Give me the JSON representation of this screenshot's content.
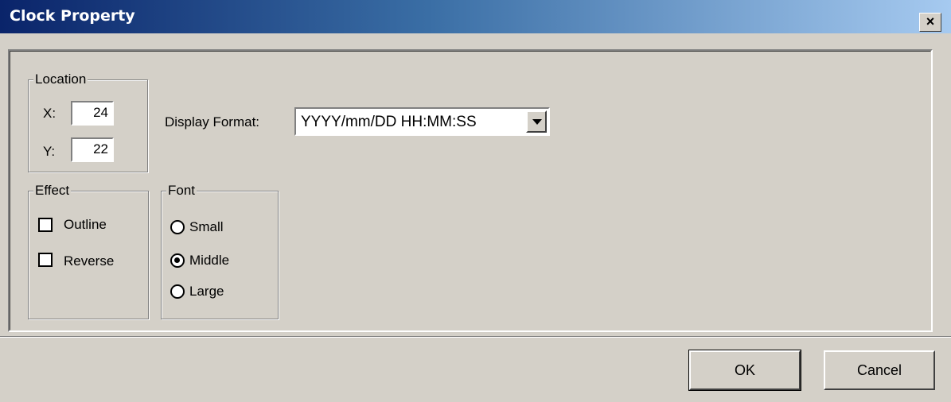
{
  "window": {
    "title": "Clock Property",
    "close_label": "×"
  },
  "location": {
    "legend": "Location",
    "x_label": "X:",
    "x_value": "24",
    "y_label": "Y:",
    "y_value": "22"
  },
  "display_format": {
    "label": "Display Format:",
    "value": "YYYY/mm/DD HH:MM:SS"
  },
  "effect": {
    "legend": "Effect",
    "outline_label": "Outline",
    "outline_checked": false,
    "reverse_label": "Reverse",
    "reverse_checked": false
  },
  "font": {
    "legend": "Font",
    "small_label": "Small",
    "middle_label": "Middle",
    "large_label": "Large",
    "selected": "Middle"
  },
  "buttons": {
    "ok_label": "OK",
    "cancel_label": "Cancel"
  },
  "colors": {
    "title_gradient_start": "#0a246a",
    "title_gradient_end": "#a6caf0",
    "dialog_bg": "#d4d0c8"
  }
}
